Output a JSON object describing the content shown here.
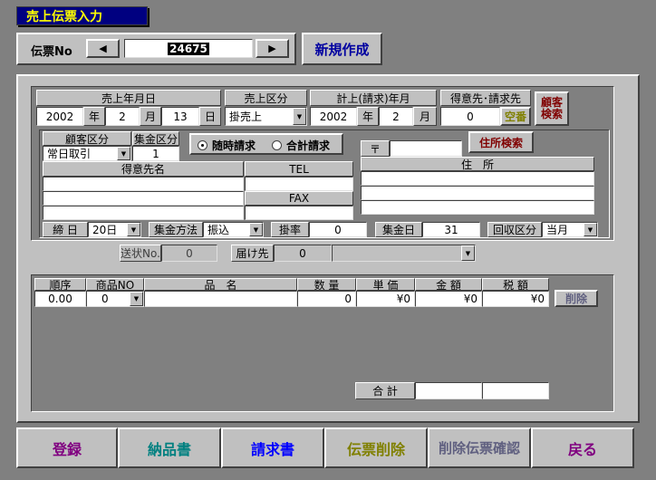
{
  "window": {
    "title": "売上伝票入力"
  },
  "header": {
    "denpyo_label": "伝票No",
    "prev_glyph": "◀",
    "next_glyph": "▶",
    "denpyo_no": "24675",
    "new_button": "新規作成"
  },
  "top": {
    "sales_date_label": "売上年月日",
    "sales_year": "2002",
    "year_unit": "年",
    "sales_month": "2",
    "month_unit": "月",
    "sales_day": "13",
    "day_unit": "日",
    "sales_type_label": "売上区分",
    "sales_type": "掛売上",
    "billing_ym_label": "計上(請求)年月",
    "billing_year": "2002",
    "billing_month": "2",
    "customer_label": "得意先･請求先",
    "customer_code": "0",
    "blank_no_button": "空番",
    "customer_search_button": "顧客検索"
  },
  "customer": {
    "kubun_label": "顧客区分",
    "kubun_value": "常日取引",
    "shukin_kubun_label": "集金区分",
    "shukin_kubun_value": "1",
    "radio_immediate": "随時請求",
    "radio_total": "合計請求",
    "name_label": "得意先名",
    "tel_label": "TEL",
    "fax_label": "FAX",
    "postal_mark": "〒",
    "address_search_button": "住所検索",
    "address_label": "住　所",
    "shime_label": "締 日",
    "shime_value": "20日",
    "method_label": "集金方法",
    "method_value": "振込",
    "rate_label": "掛率",
    "rate_value": "0",
    "collect_day_label": "集金日",
    "collect_day_value": "31",
    "recover_label": "回収区分",
    "recover_value": "当月"
  },
  "shipping": {
    "sojo_label": "送状No.",
    "sojo_value": "0",
    "todoke_label": "届け先",
    "todoke_value": "0"
  },
  "detail": {
    "headers": [
      "順序",
      "商品NO",
      "品　名",
      "数 量",
      "単 価",
      "金 額",
      "税 額"
    ],
    "row": {
      "order": "0.00",
      "product_no": "0",
      "name": "",
      "qty": "0",
      "price": "¥0",
      "amount": "¥0",
      "tax": "¥0"
    },
    "delete_button": "削除",
    "total_label": "合 計"
  },
  "footer": {
    "register": "登録",
    "delivery_note": "納品書",
    "invoice": "請求書",
    "delete_slip": "伝票削除",
    "deleted_check": "削除伝票確認",
    "back": "戻る"
  },
  "colors": {
    "title_bg": "#000080",
    "title_fg": "#ffff00",
    "new_button_fg": "#0000a0",
    "customer_search_fg": "#800000",
    "blank_no_fg": "#808000",
    "register_fg": "#800080",
    "delivery_fg": "#008080",
    "invoice_fg": "#0000ff",
    "delete_fg": "#808000",
    "deleted_check_fg": "#606080",
    "back_fg": "#800080"
  }
}
